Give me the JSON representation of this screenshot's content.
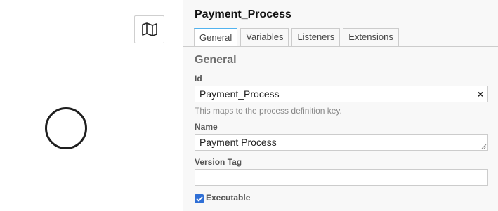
{
  "canvas": {
    "minimap_icon": "map-icon",
    "start_event": "start-event-circle"
  },
  "panel": {
    "title": "Payment_Process",
    "tabs": [
      {
        "label": "General",
        "active": true
      },
      {
        "label": "Variables",
        "active": false
      },
      {
        "label": "Listeners",
        "active": false
      },
      {
        "label": "Extensions",
        "active": false
      }
    ],
    "group_title": "General",
    "id_field": {
      "label": "Id",
      "value": "Payment_Process",
      "clear_icon": "×",
      "description": "This maps to the process definition key."
    },
    "name_field": {
      "label": "Name",
      "value": "Payment Process"
    },
    "version_tag_field": {
      "label": "Version Tag",
      "value": ""
    },
    "executable": {
      "label": "Executable",
      "checked": true
    }
  },
  "colors": {
    "tab_active_accent": "#52b3ef",
    "checkbox": "#2f6fd6",
    "panel_bg": "#f8f8f8"
  }
}
